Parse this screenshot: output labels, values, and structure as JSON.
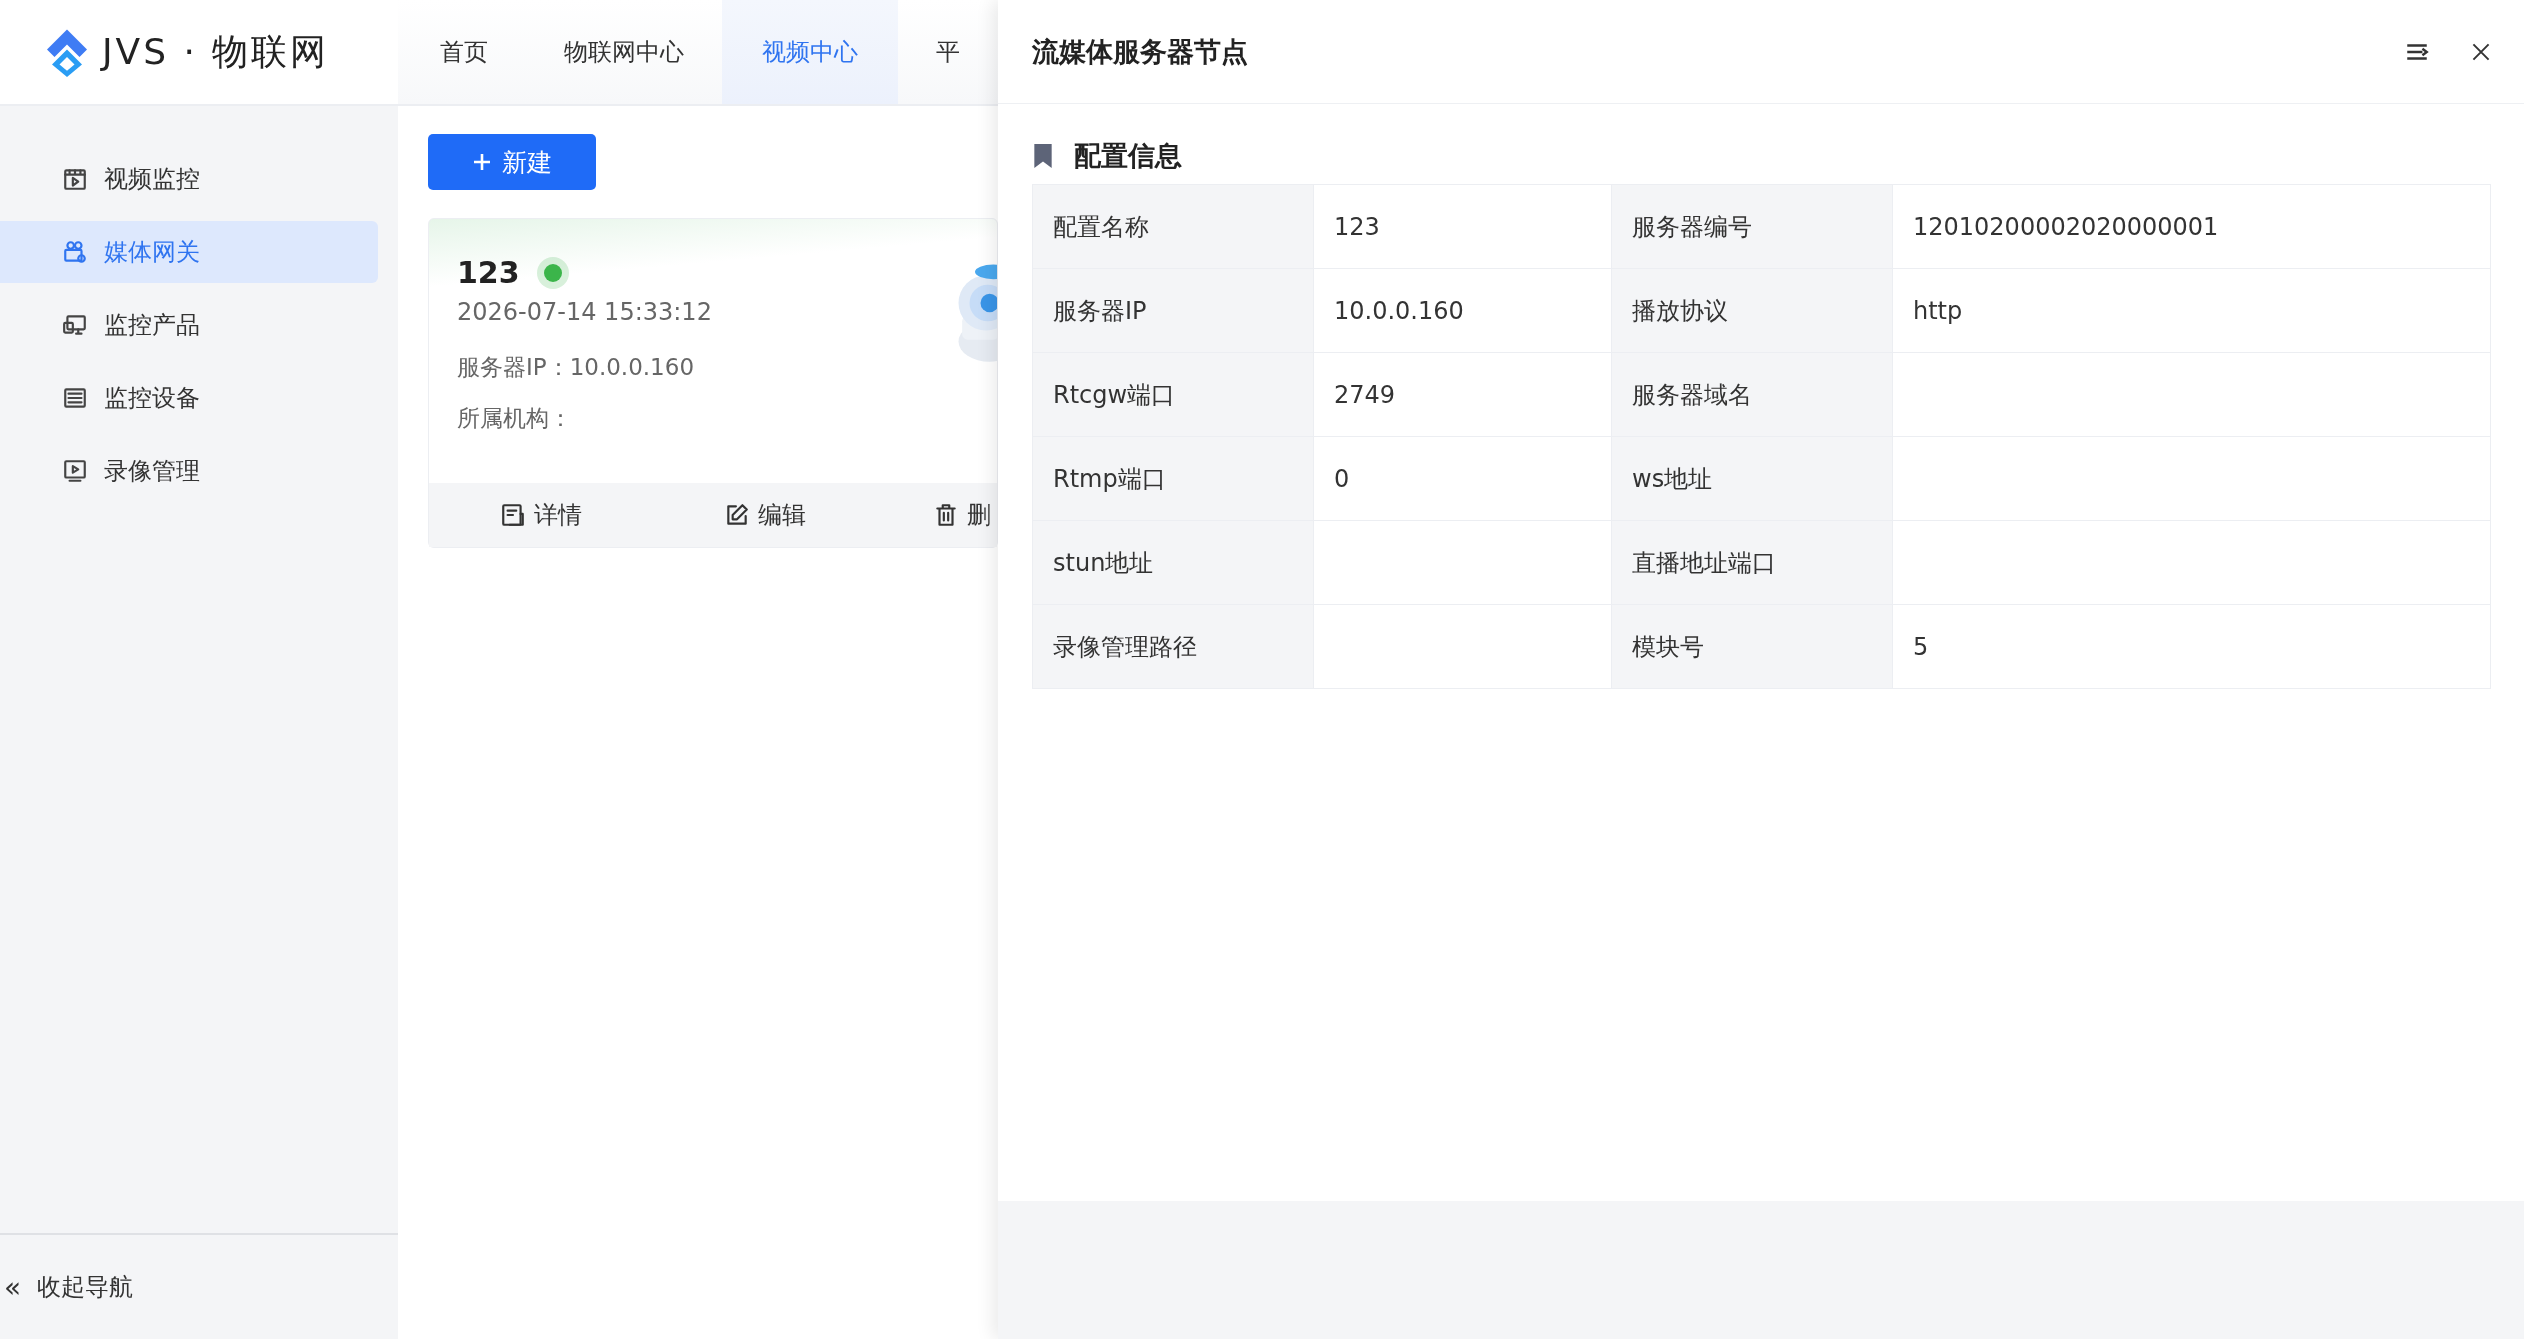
{
  "logo": {
    "text": "JVS · 物联网"
  },
  "nav_tabs": [
    {
      "label": "首页",
      "selected": false
    },
    {
      "label": "物联网中心",
      "selected": false
    },
    {
      "label": "视频中心",
      "selected": true
    },
    {
      "label": "平",
      "selected": false
    }
  ],
  "sidebar": {
    "items": [
      {
        "kind": "video",
        "label": "视频监控",
        "selected": false
      },
      {
        "kind": "gateway",
        "label": "媒体网关",
        "selected": true
      },
      {
        "kind": "product",
        "label": "监控产品",
        "selected": false
      },
      {
        "kind": "device",
        "label": "监控设备",
        "selected": false
      },
      {
        "kind": "record",
        "label": "录像管理",
        "selected": false
      }
    ],
    "collapse": {
      "icon": "«",
      "label": "收起导航"
    }
  },
  "new_button": {
    "label": "新建"
  },
  "card": {
    "title": "123",
    "online": true,
    "time": "2026-07-14 15:33:12",
    "fields": [
      {
        "label": "服务器IP：",
        "value": "10.0.0.160"
      },
      {
        "label": "所属机构："
      }
    ],
    "actions": [
      {
        "kind": "detail",
        "label": "详情"
      },
      {
        "kind": "edit",
        "label": "编辑"
      },
      {
        "kind": "delete",
        "label": "删"
      }
    ]
  },
  "drawer": {
    "title": "流媒体服务器节点",
    "section_title": "配置信息",
    "fields": [
      {
        "label": "配置名称",
        "value": "123"
      },
      {
        "label": "服务器编号",
        "value": "12010200002020000001"
      },
      {
        "label": "服务器IP",
        "value": "10.0.0.160"
      },
      {
        "label": "播放协议",
        "value": "http"
      },
      {
        "label": "Rtcgw端口",
        "value": "2749"
      },
      {
        "label": "服务器域名"
      },
      {
        "label": "Rtmp端口",
        "value": "0"
      },
      {
        "label": "ws地址"
      },
      {
        "label": "stun地址"
      },
      {
        "label": "直播地址端口"
      },
      {
        "label": "录像管理路径"
      },
      {
        "label": "模块号",
        "value": "5"
      }
    ]
  }
}
